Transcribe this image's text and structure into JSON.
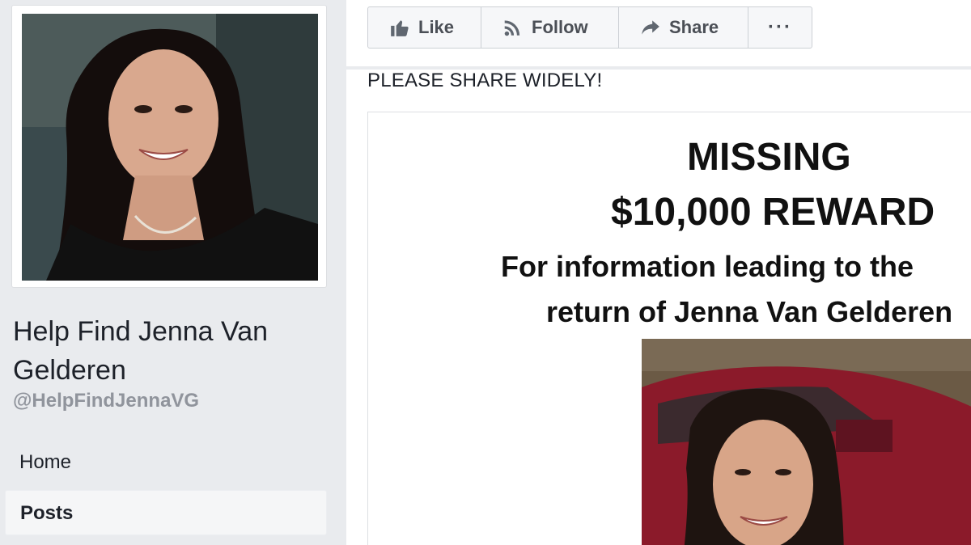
{
  "page": {
    "title": "Help Find Jenna Van Gelderen",
    "handle": "@HelpFindJennaVG"
  },
  "nav": {
    "home": "Home",
    "posts": "Posts"
  },
  "actions": {
    "like": "Like",
    "follow": "Follow",
    "share": "Share",
    "more": "···"
  },
  "post": {
    "text": "PLEASE SHARE WIDELY!",
    "poster": {
      "headline": "MISSING",
      "reward": "$10,000 REWARD",
      "info_line1": "For information leading to the",
      "info_line2": "return of Jenna Van Gelderen"
    }
  },
  "colors": {
    "sidebar_bg": "#e9ebee",
    "handle": "#90949c",
    "button_text": "#4b4f56",
    "car_red": "#8b1a2a"
  }
}
